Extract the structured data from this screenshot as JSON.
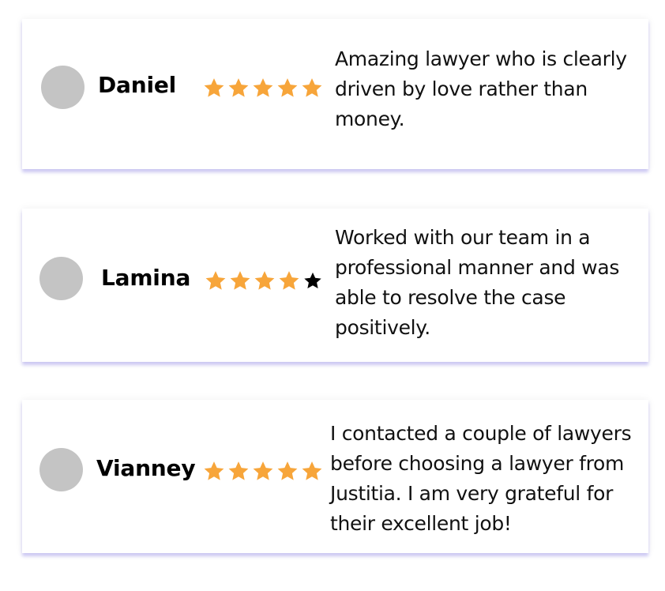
{
  "colors": {
    "star_filled": "#f7a53a",
    "star_empty": "#000000",
    "avatar": "#c4c4c4",
    "card_shadow": "#786ee6"
  },
  "reviews": [
    {
      "name": "Daniel",
      "rating": 5,
      "max_rating": 5,
      "text": "Amazing lawyer who is clearly driven by love rather than money."
    },
    {
      "name": "Lamina",
      "rating": 4,
      "max_rating": 5,
      "text": "Worked with our team in a professional manner and was able to resolve the case positively."
    },
    {
      "name": "Vianney",
      "rating": 5,
      "max_rating": 5,
      "text": "I contacted a couple of lawyers before choosing a lawyer from Justitia. I am very grateful for their excellent job!"
    }
  ]
}
